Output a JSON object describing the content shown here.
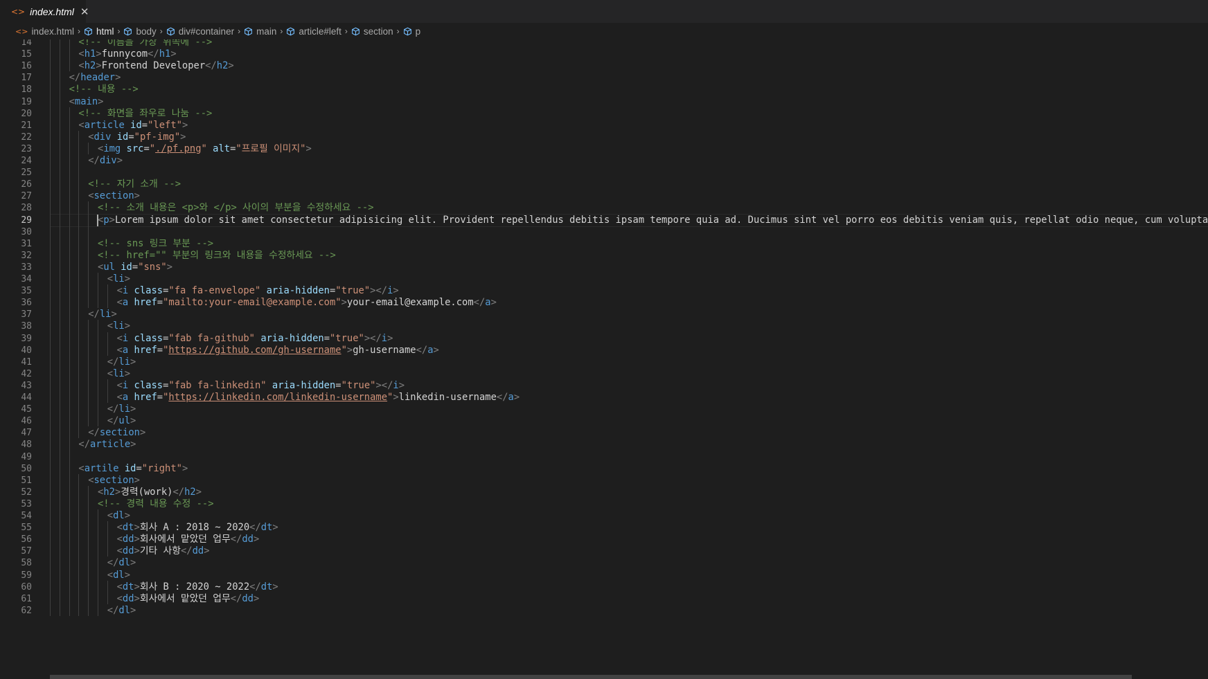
{
  "tab": {
    "icon": "<>",
    "label": "index.html",
    "close": "✕"
  },
  "breadcrumb": [
    {
      "label": "index.html",
      "icon": "html-file-icon"
    },
    {
      "label": "html",
      "icon": "element-icon",
      "active": true
    },
    {
      "label": "body",
      "icon": "element-icon"
    },
    {
      "label": "div#container",
      "icon": "element-icon"
    },
    {
      "label": "main",
      "icon": "element-icon"
    },
    {
      "label": "article#left",
      "icon": "element-icon"
    },
    {
      "label": "section",
      "icon": "element-icon"
    },
    {
      "label": "p",
      "icon": "element-icon"
    }
  ],
  "editor": {
    "current_line": 29,
    "lines": [
      {
        "n": 14,
        "indent": 3,
        "tokens": [
          [
            "c",
            "<!-- 이름을 가장 위쪽에 -->"
          ]
        ]
      },
      {
        "n": 15,
        "indent": 3,
        "tokens": [
          [
            "p",
            "<"
          ],
          [
            "t",
            "h1"
          ],
          [
            "p",
            ">"
          ],
          [
            "x",
            "funnycom"
          ],
          [
            "p",
            "</"
          ],
          [
            "t",
            "h1"
          ],
          [
            "p",
            ">"
          ]
        ]
      },
      {
        "n": 16,
        "indent": 3,
        "tokens": [
          [
            "p",
            "<"
          ],
          [
            "t",
            "h2"
          ],
          [
            "p",
            ">"
          ],
          [
            "x",
            "Frontend Developer"
          ],
          [
            "p",
            "</"
          ],
          [
            "t",
            "h2"
          ],
          [
            "p",
            ">"
          ]
        ]
      },
      {
        "n": 17,
        "indent": 2,
        "tokens": [
          [
            "p",
            "</"
          ],
          [
            "t",
            "header"
          ],
          [
            "p",
            ">"
          ]
        ]
      },
      {
        "n": 18,
        "indent": 2,
        "tokens": [
          [
            "c",
            "<!-- 내용 -->"
          ]
        ]
      },
      {
        "n": 19,
        "indent": 2,
        "tokens": [
          [
            "p",
            "<"
          ],
          [
            "t",
            "main"
          ],
          [
            "p",
            ">"
          ]
        ]
      },
      {
        "n": 20,
        "indent": 3,
        "tokens": [
          [
            "c",
            "<!-- 화면을 좌우로 나눔 -->"
          ]
        ]
      },
      {
        "n": 21,
        "indent": 3,
        "tokens": [
          [
            "p",
            "<"
          ],
          [
            "t",
            "article"
          ],
          [
            "x",
            " "
          ],
          [
            "a",
            "id"
          ],
          [
            "x",
            "="
          ],
          [
            "s",
            "\"left\""
          ],
          [
            "p",
            ">"
          ]
        ]
      },
      {
        "n": 22,
        "indent": 4,
        "tokens": [
          [
            "p",
            "<"
          ],
          [
            "t",
            "div"
          ],
          [
            "x",
            " "
          ],
          [
            "a",
            "id"
          ],
          [
            "x",
            "="
          ],
          [
            "s",
            "\"pf-img\""
          ],
          [
            "p",
            ">"
          ]
        ]
      },
      {
        "n": 23,
        "indent": 5,
        "tokens": [
          [
            "p",
            "<"
          ],
          [
            "t",
            "img"
          ],
          [
            "x",
            " "
          ],
          [
            "a",
            "src"
          ],
          [
            "x",
            "="
          ],
          [
            "s",
            "\""
          ],
          [
            "u",
            "./pf.png"
          ],
          [
            "s",
            "\""
          ],
          [
            "x",
            " "
          ],
          [
            "a",
            "alt"
          ],
          [
            "x",
            "="
          ],
          [
            "s",
            "\"프로필 이미지\""
          ],
          [
            "p",
            ">"
          ]
        ]
      },
      {
        "n": 24,
        "indent": 4,
        "tokens": [
          [
            "p",
            "</"
          ],
          [
            "t",
            "div"
          ],
          [
            "p",
            ">"
          ]
        ]
      },
      {
        "n": 25,
        "indent": 0,
        "tokens": []
      },
      {
        "n": 26,
        "indent": 4,
        "tokens": [
          [
            "c",
            "<!-- 자기 소개 -->"
          ]
        ]
      },
      {
        "n": 27,
        "indent": 4,
        "tokens": [
          [
            "p",
            "<"
          ],
          [
            "t",
            "section"
          ],
          [
            "p",
            ">"
          ]
        ]
      },
      {
        "n": 28,
        "indent": 5,
        "tokens": [
          [
            "c",
            "<!-- 소개 내용은 <p>와 </p> 사이의 부분을 수정하세요 -->"
          ]
        ]
      },
      {
        "n": 29,
        "indent": 5,
        "tokens": [
          [
            "p",
            "<"
          ],
          [
            "t",
            "p"
          ],
          [
            "p",
            ">"
          ],
          [
            "x",
            "Lorem ipsum dolor sit amet consectetur adipisicing elit. Provident repellendus debitis ipsam tempore quia ad. Ducimus sint vel porro eos debitis veniam quis, repellat odio neque, cum voluptate, natus dolo"
          ]
        ]
      },
      {
        "n": 30,
        "indent": 0,
        "tokens": []
      },
      {
        "n": 31,
        "indent": 5,
        "tokens": [
          [
            "c",
            "<!-- sns 링크 부분 -->"
          ]
        ]
      },
      {
        "n": 32,
        "indent": 5,
        "tokens": [
          [
            "c",
            "<!-- href=\"\" 부분의 링크와 내용을 수정하세요 -->"
          ]
        ]
      },
      {
        "n": 33,
        "indent": 5,
        "tokens": [
          [
            "p",
            "<"
          ],
          [
            "t",
            "ul"
          ],
          [
            "x",
            " "
          ],
          [
            "a",
            "id"
          ],
          [
            "x",
            "="
          ],
          [
            "s",
            "\"sns\""
          ],
          [
            "p",
            ">"
          ]
        ]
      },
      {
        "n": 34,
        "indent": 6,
        "tokens": [
          [
            "p",
            "<"
          ],
          [
            "t",
            "li"
          ],
          [
            "p",
            ">"
          ]
        ]
      },
      {
        "n": 35,
        "indent": 7,
        "tokens": [
          [
            "p",
            "<"
          ],
          [
            "t",
            "i"
          ],
          [
            "x",
            " "
          ],
          [
            "a",
            "class"
          ],
          [
            "x",
            "="
          ],
          [
            "s",
            "\"fa fa-envelope\""
          ],
          [
            "x",
            " "
          ],
          [
            "a",
            "aria-hidden"
          ],
          [
            "x",
            "="
          ],
          [
            "s",
            "\"true\""
          ],
          [
            "p",
            "></"
          ],
          [
            "t",
            "i"
          ],
          [
            "p",
            ">"
          ]
        ]
      },
      {
        "n": 36,
        "indent": 7,
        "tokens": [
          [
            "p",
            "<"
          ],
          [
            "t",
            "a"
          ],
          [
            "x",
            " "
          ],
          [
            "a",
            "href"
          ],
          [
            "x",
            "="
          ],
          [
            "s",
            "\"mailto:your-email@example.com\""
          ],
          [
            "p",
            ">"
          ],
          [
            "x",
            "your-email@example.com"
          ],
          [
            "p",
            "</"
          ],
          [
            "t",
            "a"
          ],
          [
            "p",
            ">"
          ]
        ]
      },
      {
        "n": 37,
        "indent": 4,
        "tokens": [
          [
            "p",
            "</"
          ],
          [
            "t",
            "li"
          ],
          [
            "p",
            ">"
          ]
        ]
      },
      {
        "n": 38,
        "indent": 6,
        "tokens": [
          [
            "p",
            "<"
          ],
          [
            "t",
            "li"
          ],
          [
            "p",
            ">"
          ]
        ]
      },
      {
        "n": 39,
        "indent": 7,
        "tokens": [
          [
            "p",
            "<"
          ],
          [
            "t",
            "i"
          ],
          [
            "x",
            " "
          ],
          [
            "a",
            "class"
          ],
          [
            "x",
            "="
          ],
          [
            "s",
            "\"fab fa-github\""
          ],
          [
            "x",
            " "
          ],
          [
            "a",
            "aria-hidden"
          ],
          [
            "x",
            "="
          ],
          [
            "s",
            "\"true\""
          ],
          [
            "p",
            "></"
          ],
          [
            "t",
            "i"
          ],
          [
            "p",
            ">"
          ]
        ]
      },
      {
        "n": 40,
        "indent": 7,
        "tokens": [
          [
            "p",
            "<"
          ],
          [
            "t",
            "a"
          ],
          [
            "x",
            " "
          ],
          [
            "a",
            "href"
          ],
          [
            "x",
            "="
          ],
          [
            "s",
            "\""
          ],
          [
            "u",
            "https://github.com/gh-username"
          ],
          [
            "s",
            "\""
          ],
          [
            "p",
            ">"
          ],
          [
            "x",
            "gh-username"
          ],
          [
            "p",
            "</"
          ],
          [
            "t",
            "a"
          ],
          [
            "p",
            ">"
          ]
        ]
      },
      {
        "n": 41,
        "indent": 6,
        "tokens": [
          [
            "p",
            "</"
          ],
          [
            "t",
            "li"
          ],
          [
            "p",
            ">"
          ]
        ]
      },
      {
        "n": 42,
        "indent": 6,
        "tokens": [
          [
            "p",
            "<"
          ],
          [
            "t",
            "li"
          ],
          [
            "p",
            ">"
          ]
        ]
      },
      {
        "n": 43,
        "indent": 7,
        "tokens": [
          [
            "p",
            "<"
          ],
          [
            "t",
            "i"
          ],
          [
            "x",
            " "
          ],
          [
            "a",
            "class"
          ],
          [
            "x",
            "="
          ],
          [
            "s",
            "\"fab fa-linkedin\""
          ],
          [
            "x",
            " "
          ],
          [
            "a",
            "aria-hidden"
          ],
          [
            "x",
            "="
          ],
          [
            "s",
            "\"true\""
          ],
          [
            "p",
            "></"
          ],
          [
            "t",
            "i"
          ],
          [
            "p",
            ">"
          ]
        ]
      },
      {
        "n": 44,
        "indent": 7,
        "tokens": [
          [
            "p",
            "<"
          ],
          [
            "t",
            "a"
          ],
          [
            "x",
            " "
          ],
          [
            "a",
            "href"
          ],
          [
            "x",
            "="
          ],
          [
            "s",
            "\""
          ],
          [
            "u",
            "https://linkedin.com/linkedin-username"
          ],
          [
            "s",
            "\""
          ],
          [
            "p",
            ">"
          ],
          [
            "x",
            "linkedin-username"
          ],
          [
            "p",
            "</"
          ],
          [
            "t",
            "a"
          ],
          [
            "p",
            ">"
          ]
        ]
      },
      {
        "n": 45,
        "indent": 6,
        "tokens": [
          [
            "p",
            "</"
          ],
          [
            "t",
            "li"
          ],
          [
            "p",
            ">"
          ]
        ]
      },
      {
        "n": 46,
        "indent": 6,
        "tokens": [
          [
            "p",
            "</"
          ],
          [
            "t",
            "ul"
          ],
          [
            "p",
            ">"
          ]
        ]
      },
      {
        "n": 47,
        "indent": 4,
        "tokens": [
          [
            "p",
            "</"
          ],
          [
            "t",
            "section"
          ],
          [
            "p",
            ">"
          ]
        ]
      },
      {
        "n": 48,
        "indent": 3,
        "tokens": [
          [
            "p",
            "</"
          ],
          [
            "t",
            "article"
          ],
          [
            "p",
            ">"
          ]
        ]
      },
      {
        "n": 49,
        "indent": 0,
        "tokens": []
      },
      {
        "n": 50,
        "indent": 3,
        "tokens": [
          [
            "p",
            "<"
          ],
          [
            "t",
            "artile"
          ],
          [
            "x",
            " "
          ],
          [
            "a",
            "id"
          ],
          [
            "x",
            "="
          ],
          [
            "s",
            "\"right\""
          ],
          [
            "p",
            ">"
          ]
        ]
      },
      {
        "n": 51,
        "indent": 4,
        "tokens": [
          [
            "p",
            "<"
          ],
          [
            "t",
            "section"
          ],
          [
            "p",
            ">"
          ]
        ]
      },
      {
        "n": 52,
        "indent": 5,
        "tokens": [
          [
            "p",
            "<"
          ],
          [
            "t",
            "h2"
          ],
          [
            "p",
            ">"
          ],
          [
            "x",
            "경력(work)"
          ],
          [
            "p",
            "</"
          ],
          [
            "t",
            "h2"
          ],
          [
            "p",
            ">"
          ]
        ]
      },
      {
        "n": 53,
        "indent": 5,
        "tokens": [
          [
            "c",
            "<!-- 경력 내용 수정 -->"
          ]
        ]
      },
      {
        "n": 54,
        "indent": 6,
        "tokens": [
          [
            "p",
            "<"
          ],
          [
            "t",
            "dl"
          ],
          [
            "p",
            ">"
          ]
        ]
      },
      {
        "n": 55,
        "indent": 7,
        "tokens": [
          [
            "p",
            "<"
          ],
          [
            "t",
            "dt"
          ],
          [
            "p",
            ">"
          ],
          [
            "x",
            "회사 A : 2018 ~ 2020"
          ],
          [
            "p",
            "</"
          ],
          [
            "t",
            "dt"
          ],
          [
            "p",
            ">"
          ]
        ]
      },
      {
        "n": 56,
        "indent": 7,
        "tokens": [
          [
            "p",
            "<"
          ],
          [
            "t",
            "dd"
          ],
          [
            "p",
            ">"
          ],
          [
            "x",
            "회사에서 맡았던 업무"
          ],
          [
            "p",
            "</"
          ],
          [
            "t",
            "dd"
          ],
          [
            "p",
            ">"
          ]
        ]
      },
      {
        "n": 57,
        "indent": 7,
        "tokens": [
          [
            "p",
            "<"
          ],
          [
            "t",
            "dd"
          ],
          [
            "p",
            ">"
          ],
          [
            "x",
            "기타 사항"
          ],
          [
            "p",
            "</"
          ],
          [
            "t",
            "dd"
          ],
          [
            "p",
            ">"
          ]
        ]
      },
      {
        "n": 58,
        "indent": 6,
        "tokens": [
          [
            "p",
            "</"
          ],
          [
            "t",
            "dl"
          ],
          [
            "p",
            ">"
          ]
        ]
      },
      {
        "n": 59,
        "indent": 6,
        "tokens": [
          [
            "p",
            "<"
          ],
          [
            "t",
            "dl"
          ],
          [
            "p",
            ">"
          ]
        ]
      },
      {
        "n": 60,
        "indent": 7,
        "tokens": [
          [
            "p",
            "<"
          ],
          [
            "t",
            "dt"
          ],
          [
            "p",
            ">"
          ],
          [
            "x",
            "회사 B : 2020 ~ 2022"
          ],
          [
            "p",
            "</"
          ],
          [
            "t",
            "dt"
          ],
          [
            "p",
            ">"
          ]
        ]
      },
      {
        "n": 61,
        "indent": 7,
        "tokens": [
          [
            "p",
            "<"
          ],
          [
            "t",
            "dd"
          ],
          [
            "p",
            ">"
          ],
          [
            "x",
            "회사에서 맡았던 업무"
          ],
          [
            "p",
            "</"
          ],
          [
            "t",
            "dd"
          ],
          [
            "p",
            ">"
          ]
        ]
      },
      {
        "n": 62,
        "indent": 6,
        "tokens": [
          [
            "p",
            "</"
          ],
          [
            "t",
            "dl"
          ],
          [
            "p",
            ">"
          ]
        ]
      }
    ]
  }
}
